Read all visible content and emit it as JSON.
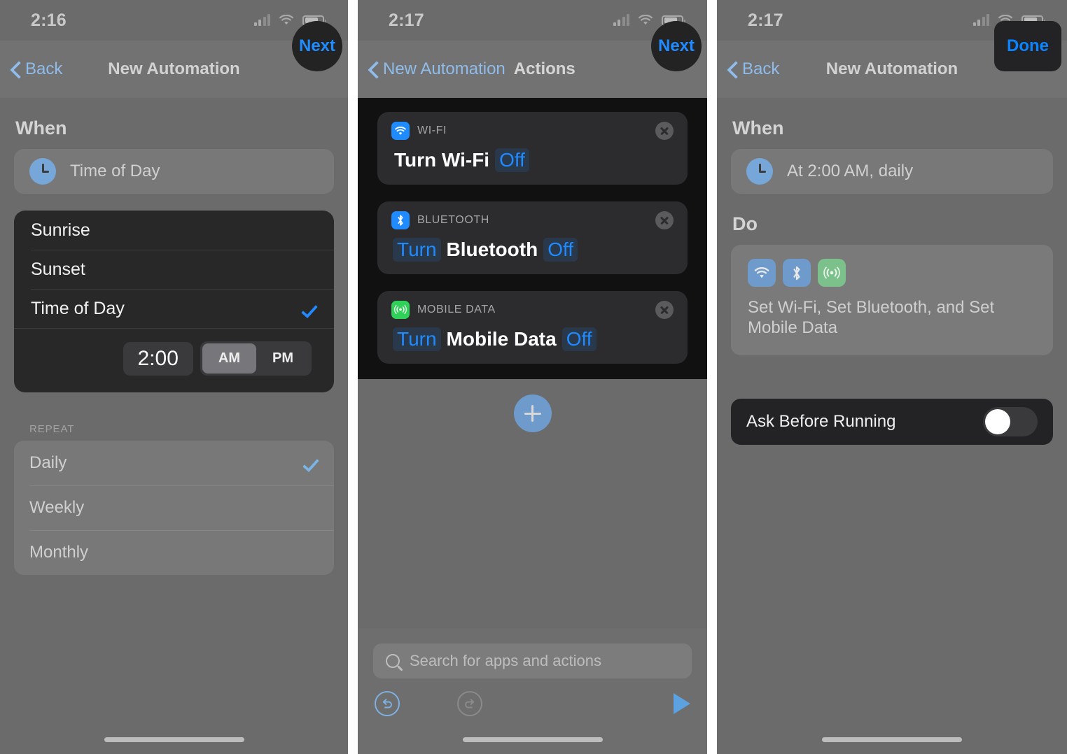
{
  "panels": [
    {
      "status": {
        "time": "2:16",
        "signal_icon": "cellular-signal-icon",
        "wifi_icon": "wifi-icon",
        "battery_icon": "battery-icon"
      },
      "nav": {
        "back_label": "Back",
        "title": "New Automation",
        "action_label": "Next"
      },
      "when": {
        "heading": "When",
        "trigger_label": "Time of Day",
        "trigger_icon": "clock-icon"
      },
      "picker": {
        "options": [
          {
            "label": "Sunrise",
            "selected": false
          },
          {
            "label": "Sunset",
            "selected": false
          },
          {
            "label": "Time of Day",
            "selected": true
          }
        ],
        "time_value": "2:00",
        "meridiem": [
          {
            "label": "AM",
            "selected": true
          },
          {
            "label": "PM",
            "selected": false
          }
        ]
      },
      "repeat": {
        "group_label": "REPEAT",
        "options": [
          {
            "label": "Daily",
            "selected": true
          },
          {
            "label": "Weekly",
            "selected": false
          },
          {
            "label": "Monthly",
            "selected": false
          }
        ]
      }
    },
    {
      "status": {
        "time": "2:17",
        "signal_icon": "cellular-signal-icon",
        "wifi_icon": "wifi-icon",
        "battery_icon": "battery-icon"
      },
      "nav": {
        "back_label": "New Automation",
        "title": "Actions",
        "action_label": "Next"
      },
      "actions": [
        {
          "app_name": "WI-FI",
          "app_icon": "wifi-icon",
          "icon_color": "#1f8bff",
          "remove_icon": "close-icon",
          "parts": [
            {
              "text": "Turn Wi-Fi",
              "type": "plain"
            },
            {
              "text": "Off",
              "type": "token"
            }
          ]
        },
        {
          "app_name": "BLUETOOTH",
          "app_icon": "bluetooth-icon",
          "icon_color": "#1f8bff",
          "remove_icon": "close-icon",
          "parts": [
            {
              "text": "Turn",
              "type": "token"
            },
            {
              "text": "Bluetooth",
              "type": "plain"
            },
            {
              "text": "Off",
              "type": "token"
            }
          ]
        },
        {
          "app_name": "MOBILE DATA",
          "app_icon": "cellular-icon",
          "icon_color": "#30d158",
          "remove_icon": "close-icon",
          "parts": [
            {
              "text": "Turn",
              "type": "token"
            },
            {
              "text": "Mobile Data",
              "type": "plain"
            },
            {
              "text": "Off",
              "type": "token"
            }
          ]
        }
      ],
      "add_action_icon": "plus-icon",
      "toolbar": {
        "search_placeholder": "Search for apps and actions",
        "search_icon": "search-icon",
        "undo_icon": "undo-icon",
        "redo_icon": "redo-icon",
        "run_icon": "play-icon"
      }
    },
    {
      "status": {
        "time": "2:17",
        "signal_icon": "cellular-signal-icon",
        "wifi_icon": "wifi-icon",
        "battery_icon": "battery-icon"
      },
      "nav": {
        "back_label": "Back",
        "title": "New Automation",
        "action_label": "Done"
      },
      "when": {
        "heading": "When",
        "trigger_label": "At 2:00 AM, daily",
        "trigger_icon": "clock-icon"
      },
      "do": {
        "heading": "Do",
        "icons": [
          {
            "name": "wifi-icon",
            "color": "#6e9bcb"
          },
          {
            "name": "bluetooth-icon",
            "color": "#6e9bcb"
          },
          {
            "name": "cellular-icon",
            "color": "#7cc08c"
          }
        ],
        "summary": "Set Wi-Fi, Set Bluetooth, and Set Mobile Data"
      },
      "ask": {
        "label": "Ask Before Running",
        "enabled": false
      }
    }
  ]
}
